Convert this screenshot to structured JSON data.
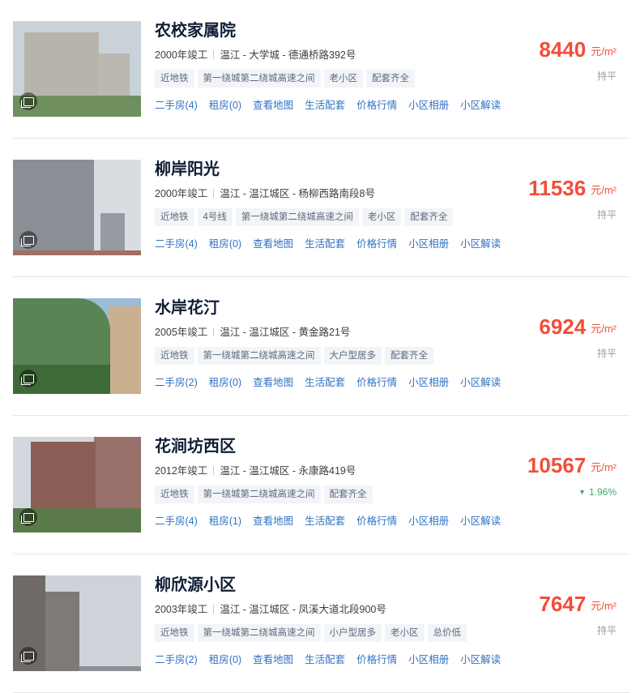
{
  "items": [
    {
      "name": "农校家属院",
      "year": "2000年竣工",
      "location": "温江 - 大学城 - 德通桥路392号",
      "tags": [
        "近地铁",
        "第一绕城第二绕城高速之间",
        "老小区",
        "配套齐全"
      ],
      "price": "8440",
      "unit": "元/m²",
      "trend": "持平",
      "trend_dir": "flat",
      "links": [
        {
          "label": "二手房",
          "count": "(4)"
        },
        {
          "label": "租房",
          "count": "(0)"
        },
        {
          "label": "查看地图",
          "count": ""
        },
        {
          "label": "生活配套",
          "count": ""
        },
        {
          "label": "价格行情",
          "count": ""
        },
        {
          "label": "小区相册",
          "count": ""
        },
        {
          "label": "小区解读",
          "count": ""
        }
      ],
      "photo_colors": {
        "sky": "#c8d2d8",
        "building": "#b9b4ab",
        "ground": "#6f8f5e"
      }
    },
    {
      "name": "柳岸阳光",
      "year": "2000年竣工",
      "location": "温江 - 温江城区 - 杨柳西路南段8号",
      "tags": [
        "近地铁",
        "4号线",
        "第一绕城第二绕城高速之间",
        "老小区",
        "配套齐全"
      ],
      "price": "11536",
      "unit": "元/m²",
      "trend": "持平",
      "trend_dir": "flat",
      "links": [
        {
          "label": "二手房",
          "count": "(4)"
        },
        {
          "label": "租房",
          "count": "(0)"
        },
        {
          "label": "查看地图",
          "count": ""
        },
        {
          "label": "生活配套",
          "count": ""
        },
        {
          "label": "价格行情",
          "count": ""
        },
        {
          "label": "小区相册",
          "count": ""
        },
        {
          "label": "小区解读",
          "count": ""
        }
      ],
      "photo_colors": {
        "sky": "#d9dde2",
        "building": "#8a8f96",
        "ground": "#a07060"
      }
    },
    {
      "name": "水岸花汀",
      "year": "2005年竣工",
      "location": "温江 - 温江城区 - 黄金路21号",
      "tags": [
        "近地铁",
        "第一绕城第二绕城高速之间",
        "大户型居多",
        "配套齐全"
      ],
      "price": "6924",
      "unit": "元/m²",
      "trend": "持平",
      "trend_dir": "flat",
      "links": [
        {
          "label": "二手房",
          "count": "(2)"
        },
        {
          "label": "租房",
          "count": "(0)"
        },
        {
          "label": "查看地图",
          "count": ""
        },
        {
          "label": "生活配套",
          "count": ""
        },
        {
          "label": "价格行情",
          "count": ""
        },
        {
          "label": "小区相册",
          "count": ""
        },
        {
          "label": "小区解读",
          "count": ""
        }
      ],
      "photo_colors": {
        "sky": "#9bbbd6",
        "building": "#c9b08f",
        "ground": "#3d6a36"
      }
    },
    {
      "name": "花涧坊西区",
      "year": "2012年竣工",
      "location": "温江 - 温江城区 - 永康路419号",
      "tags": [
        "近地铁",
        "第一绕城第二绕城高速之间",
        "配套齐全"
      ],
      "price": "10567",
      "unit": "元/m²",
      "trend": "1.96%",
      "trend_dir": "down",
      "links": [
        {
          "label": "二手房",
          "count": "(4)"
        },
        {
          "label": "租房",
          "count": "(1)"
        },
        {
          "label": "查看地图",
          "count": ""
        },
        {
          "label": "生活配套",
          "count": ""
        },
        {
          "label": "价格行情",
          "count": ""
        },
        {
          "label": "小区相册",
          "count": ""
        },
        {
          "label": "小区解读",
          "count": ""
        }
      ],
      "photo_colors": {
        "sky": "#d3d8de",
        "building": "#8c5f56",
        "ground": "#5b7a4a"
      }
    },
    {
      "name": "柳欣源小区",
      "year": "2003年竣工",
      "location": "温江 - 温江城区 - 凤溪大道北段900号",
      "tags": [
        "近地铁",
        "第一绕城第二绕城高速之间",
        "小户型居多",
        "老小区",
        "总价低"
      ],
      "price": "7647",
      "unit": "元/m²",
      "trend": "持平",
      "trend_dir": "flat",
      "links": [
        {
          "label": "二手房",
          "count": "(2)"
        },
        {
          "label": "租房",
          "count": "(0)"
        },
        {
          "label": "查看地图",
          "count": ""
        },
        {
          "label": "生活配套",
          "count": ""
        },
        {
          "label": "价格行情",
          "count": ""
        },
        {
          "label": "小区相册",
          "count": ""
        },
        {
          "label": "小区解读",
          "count": ""
        }
      ],
      "photo_colors": {
        "sky": "#cdd3d9",
        "building": "#6f6a66",
        "ground": "#8d8f92"
      }
    }
  ]
}
